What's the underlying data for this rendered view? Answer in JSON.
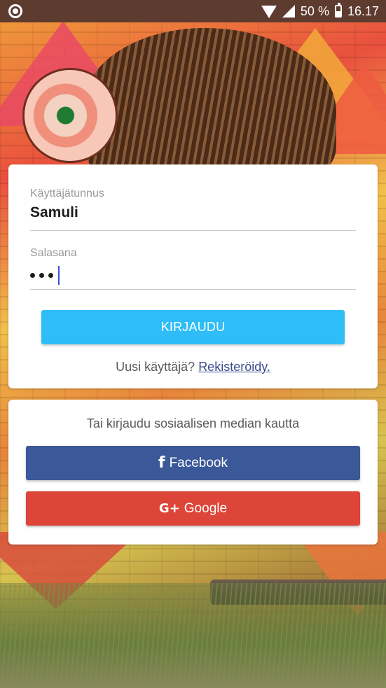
{
  "status_bar": {
    "battery_percent": "50 %",
    "time": "16.17",
    "icons": [
      "notification-icon",
      "wifi-icon",
      "signal-icon",
      "battery-icon"
    ]
  },
  "login": {
    "username_label": "Käyttäjätunnus",
    "username_value": "Samuli",
    "password_label": "Salasana",
    "password_masked_length": 3,
    "login_button": "KIRJAUDU",
    "new_user_text": "Uusi käyttäjä?",
    "register_link": "Rekisteröidy."
  },
  "social": {
    "title": "Tai kirjaudu sosiaalisen median kautta",
    "facebook_label": "Facebook",
    "google_label": "Google",
    "facebook_icon": "facebook-icon",
    "google_icon": "google-plus-icon",
    "colors": {
      "facebook": "#3b5898",
      "google": "#dd4539",
      "login_button": "#2ebdf7"
    }
  }
}
